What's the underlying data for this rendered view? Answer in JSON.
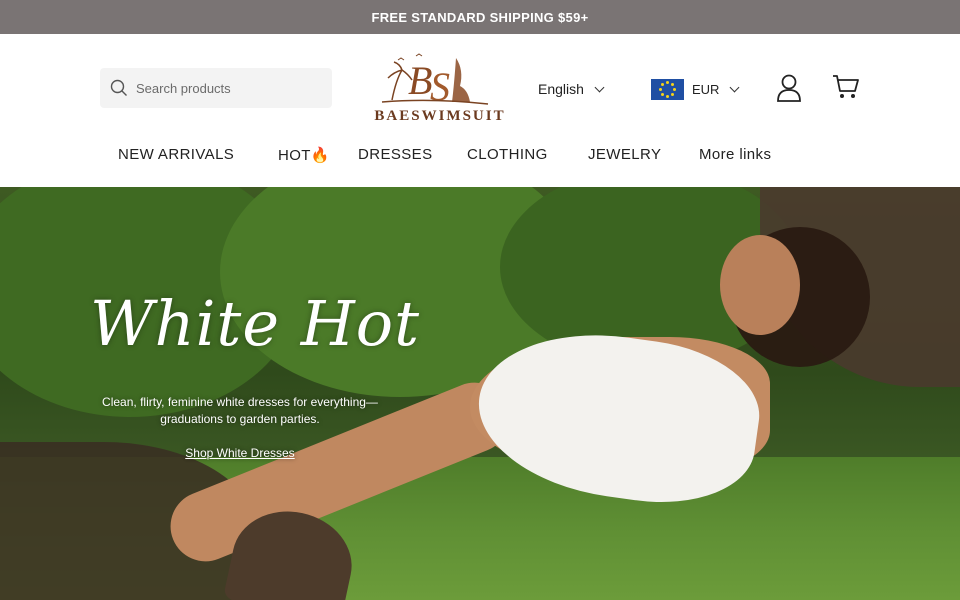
{
  "announcement": {
    "text": "FREE STANDARD SHIPPING $59+"
  },
  "search": {
    "placeholder": "Search products"
  },
  "logo": {
    "text": "BAESWIMSUIT",
    "monogram": "BS"
  },
  "language": {
    "selected": "English"
  },
  "currency": {
    "selected": "EUR"
  },
  "icons": {
    "search": "search-icon",
    "user": "user-icon",
    "cart": "cart-icon",
    "flag": "eu-flag-icon"
  },
  "nav": {
    "items": [
      {
        "label": "NEW ARRIVALS"
      },
      {
        "label": "HOT🔥"
      },
      {
        "label": "DRESSES"
      },
      {
        "label": "CLOTHING"
      },
      {
        "label": "JEWELRY"
      },
      {
        "label": "More links"
      }
    ]
  },
  "hero": {
    "title": "White Hot",
    "subtitle_line1": "Clean, flirty, feminine white dresses for everything—",
    "subtitle_line2": "graduations to garden parties.",
    "cta": "Shop White Dresses"
  },
  "colors": {
    "announcement_bg": "#7a7474",
    "logo_brown": "#6b3a1f"
  }
}
